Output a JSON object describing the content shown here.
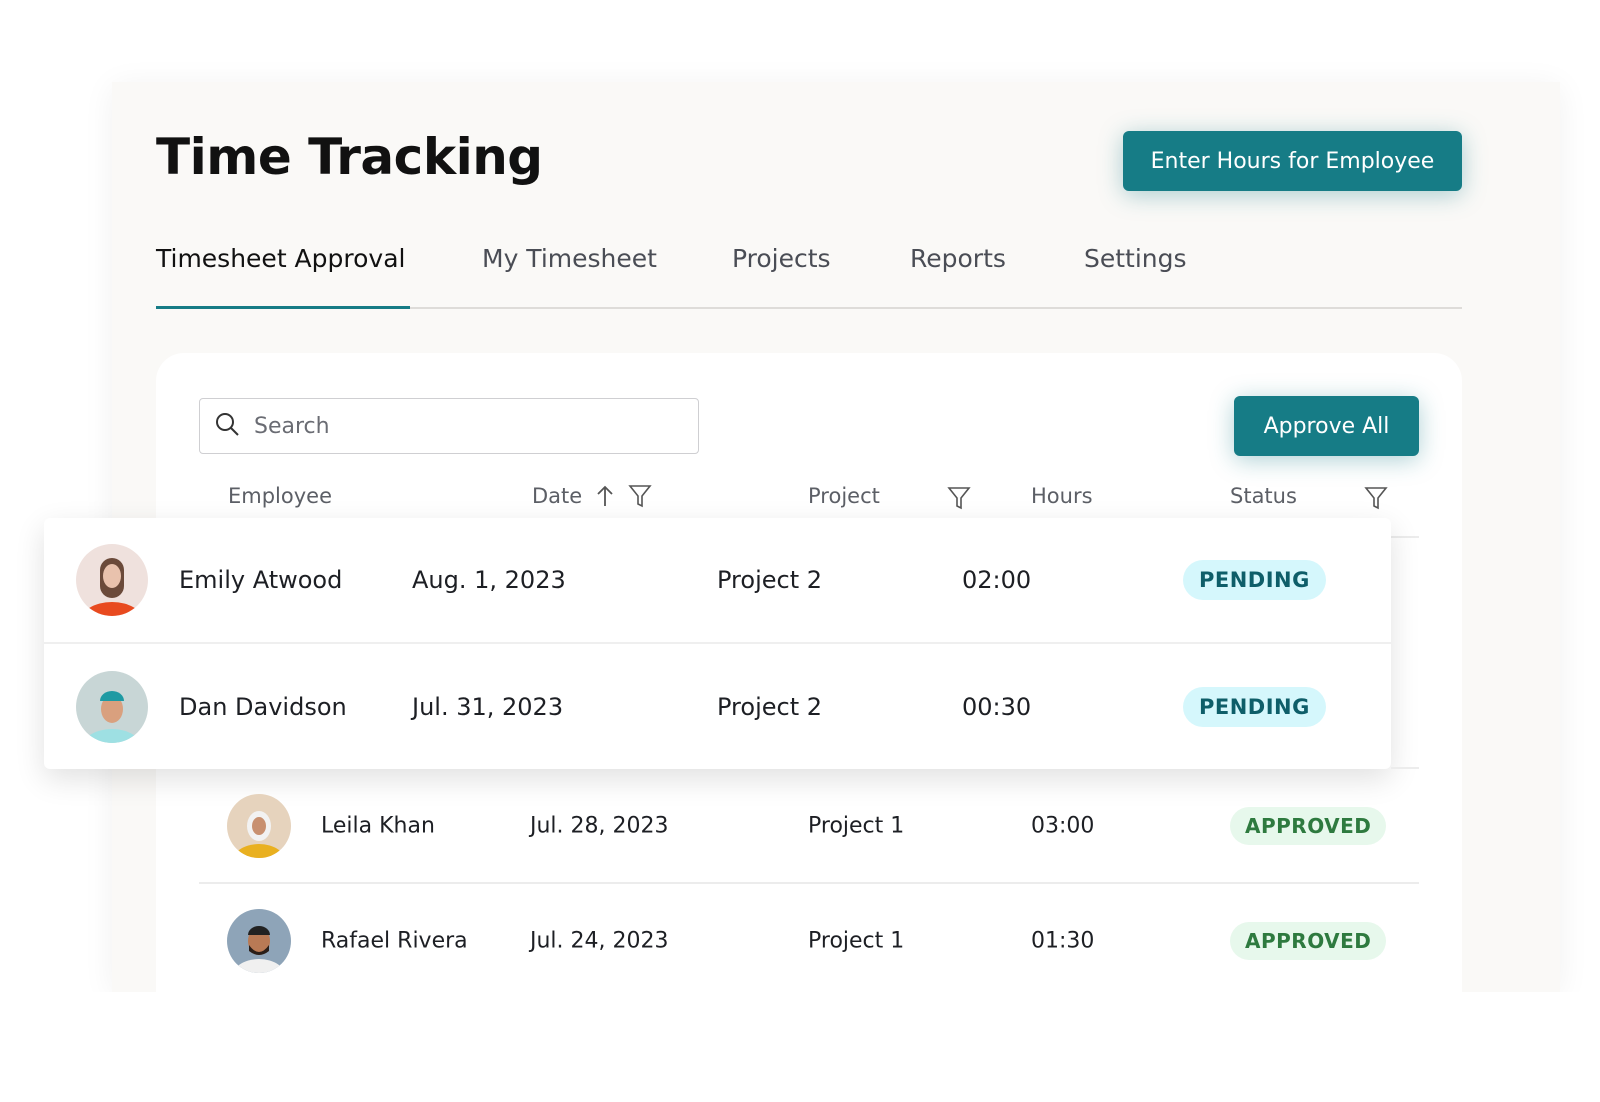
{
  "header": {
    "title": "Time Tracking",
    "enter_hours_label": "Enter Hours for Employee"
  },
  "tabs": [
    {
      "label": "Timesheet Approval",
      "active": true
    },
    {
      "label": "My Timesheet"
    },
    {
      "label": "Projects"
    },
    {
      "label": "Reports"
    },
    {
      "label": "Settings"
    }
  ],
  "toolbar": {
    "search_placeholder": "Search",
    "approve_all_label": "Approve All"
  },
  "columns": {
    "employee": "Employee",
    "date": "Date",
    "project": "Project",
    "hours": "Hours",
    "status": "Status"
  },
  "colors": {
    "accent": "#167c86",
    "pending_bg": "#d5f7fc",
    "pending_text": "#0e5e69",
    "approved_bg": "#e7f8ec",
    "approved_text": "#2e7a3f"
  },
  "rows": [
    {
      "name": "Emily Atwood",
      "date": "Aug. 1, 2023",
      "project": "Project 2",
      "hours": "02:00",
      "status": "PENDING"
    },
    {
      "name": "Dan Davidson",
      "date": "Jul. 31, 2023",
      "project": "Project 2",
      "hours": "00:30",
      "status": "PENDING"
    },
    {
      "name": "Leila Khan",
      "date": "Jul. 28, 2023",
      "project": "Project 1",
      "hours": "03:00",
      "status": "APPROVED"
    },
    {
      "name": "Rafael Rivera",
      "date": "Jul. 24, 2023",
      "project": "Project 1",
      "hours": "01:30",
      "status": "APPROVED"
    }
  ]
}
